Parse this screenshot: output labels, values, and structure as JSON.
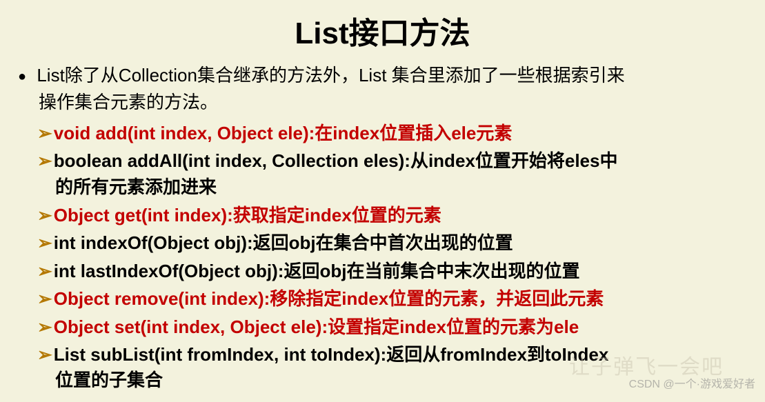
{
  "title": "List接口方法",
  "intro_line1": "List除了从Collection集合继承的方法外，List 集合里添加了一些根据索引来",
  "intro_line2": "操作集合元素的方法。",
  "methods": [
    {
      "text": "void add(int index, Object ele):在index位置插入ele元素",
      "color": "red",
      "cont": ""
    },
    {
      "text": "boolean addAll(int index, Collection eles):从index位置开始将eles中",
      "color": "black",
      "cont": "的所有元素添加进来"
    },
    {
      "text": "Object get(int index):获取指定index位置的元素",
      "color": "red",
      "cont": ""
    },
    {
      "text": "int indexOf(Object obj):返回obj在集合中首次出现的位置",
      "color": "black",
      "cont": ""
    },
    {
      "text": "int lastIndexOf(Object obj):返回obj在当前集合中末次出现的位置",
      "color": "black",
      "cont": ""
    },
    {
      "text": "Object remove(int index):移除指定index位置的元素，并返回此元素",
      "color": "red",
      "cont": ""
    },
    {
      "text": "Object set(int index, Object ele):设置指定index位置的元素为ele",
      "color": "red",
      "cont": ""
    },
    {
      "text": "List subList(int fromIndex, int toIndex):返回从fromIndex到toIndex",
      "color": "black",
      "cont": "位置的子集合"
    }
  ],
  "watermark": "CSDN @一个·游戏爱好者",
  "ghost": "让子弹飞一会吧"
}
